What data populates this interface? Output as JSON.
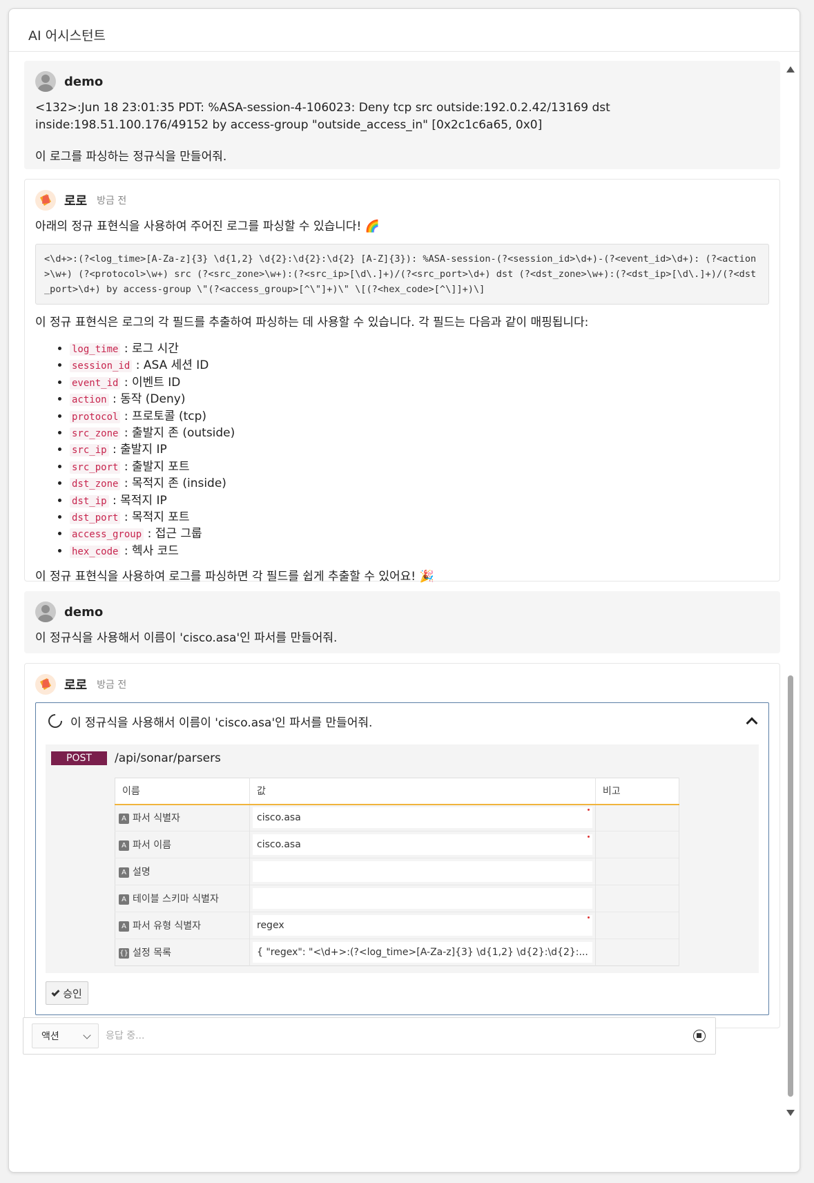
{
  "window": {
    "title": "AI 어시스턴트"
  },
  "messages": {
    "user1": {
      "name": "demo",
      "log": "<132>:Jun 18 23:01:35 PDT: %ASA-session-4-106023: Deny tcp src outside:192.0.2.42/13169 dst inside:198.51.100.176/49152 by access-group \"outside_access_in\" [0x2c1c6a65, 0x0]",
      "request": "이 로그를 파싱하는 정규식을 만들어줘."
    },
    "bot1": {
      "name": "로로",
      "time": "방금 전",
      "intro": "아래의 정규 표현식을 사용하여 주어진 로그를 파싱할 수 있습니다! 🌈",
      "regex": "<\\d+>:(?<log_time>[A-Za-z]{3} \\d{1,2} \\d{2}:\\d{2}:\\d{2} [A-Z]{3}): %ASA-session-(?<session_id>\\d+)-(?<event_id>\\d+): (?<action>\\w+) (?<protocol>\\w+) src (?<src_zone>\\w+):(?<src_ip>[\\d\\.]+)/(?<src_port>\\d+) dst (?<dst_zone>\\w+):(?<dst_ip>[\\d\\.]+)/(?<dst_port>\\d+) by access-group \\\"(?<access_group>[^\\\"]+)\\\" \\[(?<hex_code>[^\\]]+)\\]",
      "desc": "이 정규 표현식은 로그의 각 필드를 추출하여 파싱하는 데 사용할 수 있습니다. 각 필드는 다음과 같이 매핑됩니다:",
      "fields": [
        {
          "code": "log_time",
          "label": ": 로그 시간"
        },
        {
          "code": "session_id",
          "label": ": ASA 세션 ID"
        },
        {
          "code": "event_id",
          "label": ": 이벤트 ID"
        },
        {
          "code": "action",
          "label": ": 동작 (Deny)"
        },
        {
          "code": "protocol",
          "label": ": 프로토콜 (tcp)"
        },
        {
          "code": "src_zone",
          "label": ": 출발지 존 (outside)"
        },
        {
          "code": "src_ip",
          "label": ": 출발지 IP"
        },
        {
          "code": "src_port",
          "label": ": 출발지 포트"
        },
        {
          "code": "dst_zone",
          "label": ": 목적지 존 (inside)"
        },
        {
          "code": "dst_ip",
          "label": ": 목적지 IP"
        },
        {
          "code": "dst_port",
          "label": ": 목적지 포트"
        },
        {
          "code": "access_group",
          "label": ": 접근 그룹"
        },
        {
          "code": "hex_code",
          "label": ": 헥사 코드"
        }
      ],
      "outro": "이 정규 표현식을 사용하여 로그를 파싱하면 각 필드를 쉽게 추출할 수 있어요! 🎉"
    },
    "user2": {
      "name": "demo",
      "request": "이 정규식을 사용해서 이름이 'cisco.asa'인 파서를 만들어줘."
    },
    "bot2": {
      "name": "로로",
      "time": "방금 전",
      "task_title": "이 정규식을 사용해서 이름이 'cisco.asa'인 파서를 만들어줘.",
      "method": "POST",
      "path": "/api/sonar/parsers",
      "columns": [
        "이름",
        "값",
        "비고"
      ],
      "params": [
        {
          "type": "A",
          "name": "파서 식별자",
          "value": "cisco.asa",
          "required": true
        },
        {
          "type": "A",
          "name": "파서 이름",
          "value": "cisco.asa",
          "required": true
        },
        {
          "type": "A",
          "name": "설명",
          "value": "",
          "required": false
        },
        {
          "type": "A",
          "name": "테이블 스키마 식별자",
          "value": "",
          "required": false
        },
        {
          "type": "A",
          "name": "파서 유형 식별자",
          "value": "regex",
          "required": true
        },
        {
          "type": "{}",
          "name": "설정 목록",
          "value": "{ \"regex\": \"<\\d+>:(?<log_time>[A-Za-z]{3} \\d{1,2} \\d{2}:\\d{2}:...",
          "required": false
        }
      ],
      "approve_label": "승인"
    }
  },
  "input_bar": {
    "select_value": "액션",
    "placeholder": "응답 중..."
  }
}
